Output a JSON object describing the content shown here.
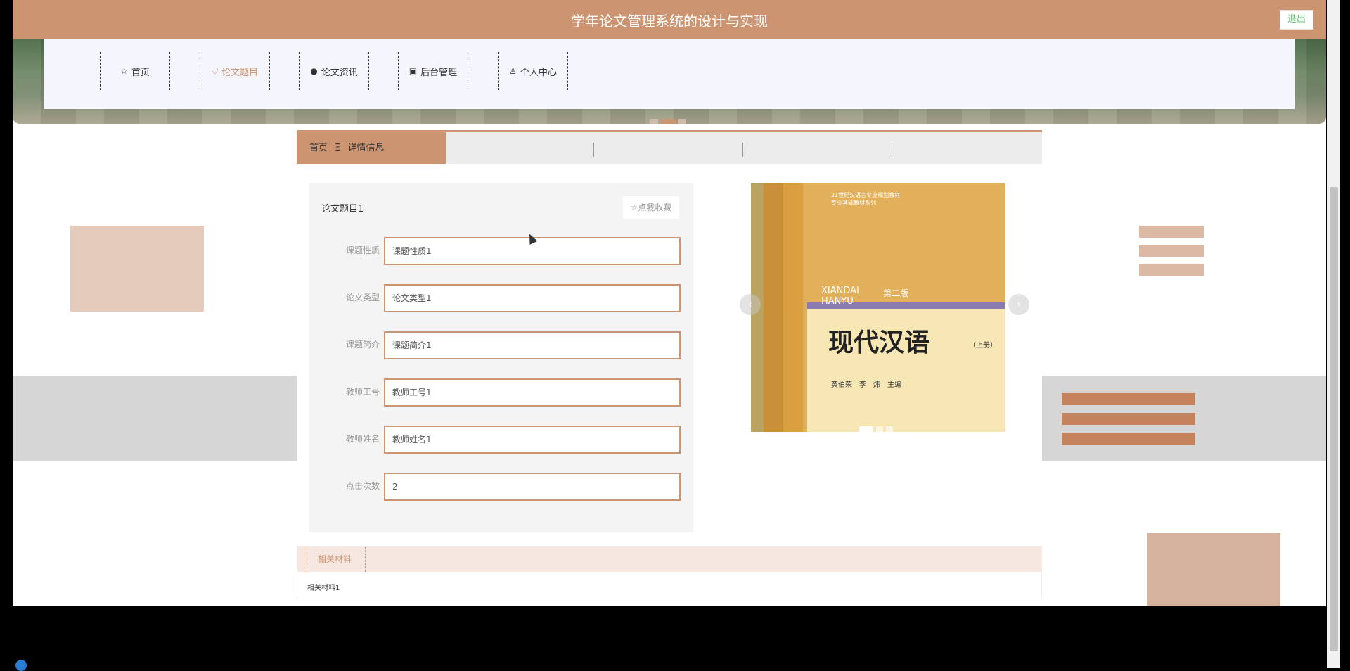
{
  "header": {
    "title": "学年论文管理系统的设计与实现",
    "logout_label": "退出"
  },
  "nav": {
    "items": [
      {
        "label": "首页",
        "icon": "star-icon"
      },
      {
        "label": "论文题目",
        "icon": "bag-icon"
      },
      {
        "label": "论文资讯",
        "icon": "info-icon"
      },
      {
        "label": "后台管理",
        "icon": "box-icon"
      },
      {
        "label": "个人中心",
        "icon": "user-icon"
      }
    ],
    "active_index": 1
  },
  "breadcrumb": {
    "home": "首页",
    "separator": "Ξ",
    "current": "详情信息"
  },
  "detail": {
    "title": "论文题目1",
    "favorite_label": "☆点我收藏",
    "fields": [
      {
        "label": "课题性质",
        "value": "课题性质1"
      },
      {
        "label": "论文类型",
        "value": "论文类型1"
      },
      {
        "label": "课题简介",
        "value": "课题简介1"
      },
      {
        "label": "教师工号",
        "value": "教师工号1"
      },
      {
        "label": "教师姓名",
        "value": "教师姓名1"
      },
      {
        "label": "点击次数",
        "value": "2"
      }
    ]
  },
  "book_image": {
    "series_text": "21世纪汉语言专业规划教材\n专业基础教材系列",
    "pinyin": "XIANDAI\nHANYU",
    "edition": "第二版",
    "title": "现代汉语",
    "volume": "（上册）",
    "authors": "黄伯荣　李　炜　主编"
  },
  "materials": {
    "tab_label": "相关材料",
    "content": "相关材料1"
  },
  "colors": {
    "accent": "#cc9470",
    "accent_light": "#f6e7e0",
    "panel": "#f4f4f4"
  }
}
